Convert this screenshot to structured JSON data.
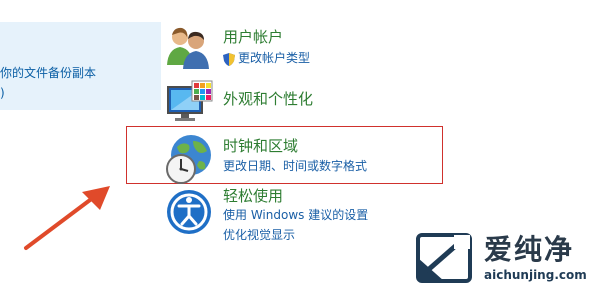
{
  "left_panel": {
    "line1": "你的文件备份副本",
    "line2": ")"
  },
  "categories": [
    {
      "title": "用户帐户",
      "links": [
        "更改帐户类型"
      ],
      "icon": "users-icon"
    },
    {
      "title": "外观和个性化",
      "links": [],
      "icon": "monitor-palette-icon"
    },
    {
      "title": "时钟和区域",
      "links": [
        "更改日期、时间或数字格式"
      ],
      "icon": "clock-globe-icon"
    },
    {
      "title": "轻松使用",
      "links": [
        "使用 Windows 建议的设置",
        "优化视觉显示"
      ],
      "icon": "ease-of-access-icon"
    }
  ],
  "watermark": {
    "title": "爱纯净",
    "domain": "aichunjing.com"
  },
  "colors": {
    "category_title": "#2e7d32",
    "link": "#1a5fa6",
    "highlight_border": "#d0312d",
    "arrow": "#e04a2a"
  }
}
